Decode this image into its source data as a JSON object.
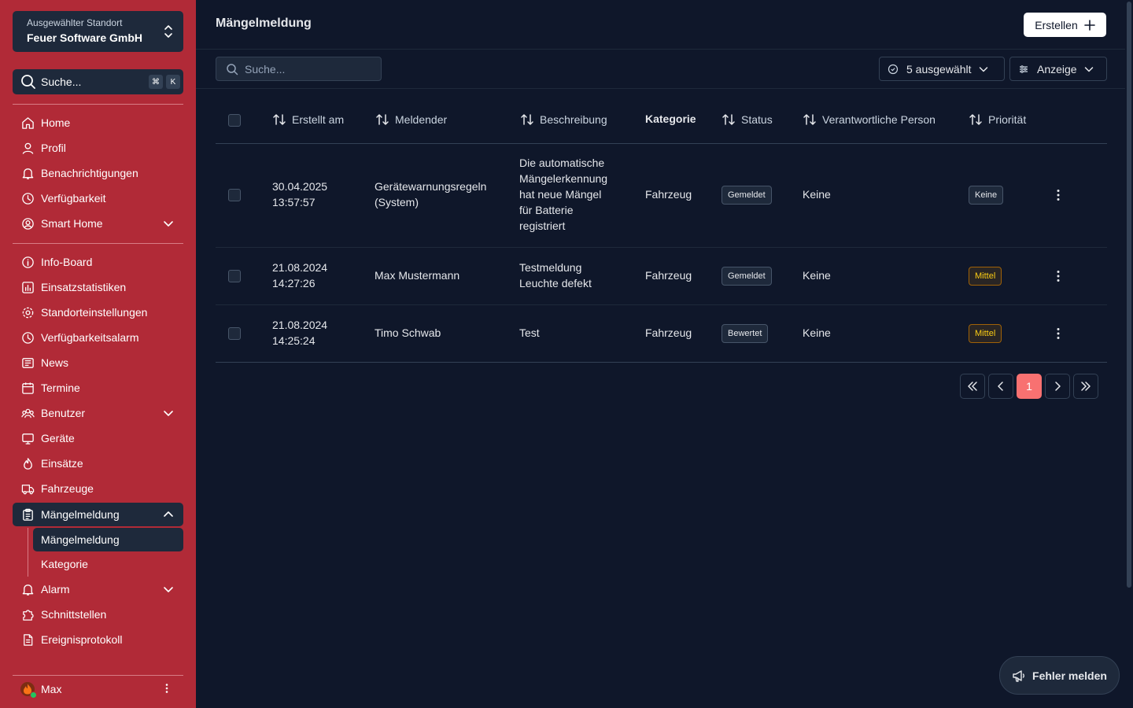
{
  "sidebar": {
    "site_label": "Ausgewählter Standort",
    "site_value": "Feuer Software GmbH",
    "search_label": "Suche...",
    "search_kbd": [
      "⌘",
      "K"
    ],
    "items": [
      {
        "label": "Home"
      },
      {
        "label": "Profil"
      },
      {
        "label": "Benachrichtigungen"
      },
      {
        "label": "Verfügbarkeit"
      },
      {
        "label": "Smart Home"
      },
      {
        "label": "Info-Board"
      },
      {
        "label": "Einsatzstatistiken"
      },
      {
        "label": "Standorteinstellungen"
      },
      {
        "label": "Verfügbarkeitsalarm"
      },
      {
        "label": "News"
      },
      {
        "label": "Termine"
      },
      {
        "label": "Benutzer"
      },
      {
        "label": "Geräte"
      },
      {
        "label": "Einsätze"
      },
      {
        "label": "Fahrzeuge"
      },
      {
        "label": "Mängelmeldung"
      },
      {
        "label": "Alarm"
      },
      {
        "label": "Schnittstellen"
      },
      {
        "label": "Ereignisprotokoll"
      }
    ],
    "subitems": [
      {
        "label": "Mängelmeldung"
      },
      {
        "label": "Kategorie"
      }
    ],
    "user": "Max"
  },
  "header": {
    "title": "Mängelmeldung",
    "create_label": "Erstellen"
  },
  "toolbar": {
    "search_placeholder": "Suche...",
    "selected_label": "5 ausgewählt",
    "view_label": "Anzeige"
  },
  "table": {
    "columns": [
      "Erstellt am",
      "Meldender",
      "Beschreibung",
      "Kategorie",
      "Status",
      "Verantwortliche Person",
      "Priorität"
    ],
    "rows": [
      {
        "created": [
          "30.04.2025",
          "13:57:57"
        ],
        "reporter": [
          "Gerätewarnungsregeln",
          "(System)"
        ],
        "description": [
          "Die automatische",
          "Mängelerkennung",
          "hat neue Mängel",
          "für Batterie",
          "registriert"
        ],
        "category": "Fahrzeug",
        "status": "Gemeldet",
        "responsible": "Keine",
        "priority": "Keine"
      },
      {
        "created": [
          "21.08.2024",
          "14:27:26"
        ],
        "reporter": [
          "Max Mustermann"
        ],
        "description": [
          "Testmeldung",
          "Leuchte defekt"
        ],
        "category": "Fahrzeug",
        "status": "Gemeldet",
        "responsible": "Keine",
        "priority": "Mittel"
      },
      {
        "created": [
          "21.08.2024",
          "14:25:24"
        ],
        "reporter": [
          "Timo Schwab"
        ],
        "description": [
          "Test"
        ],
        "category": "Fahrzeug",
        "status": "Bewertet",
        "responsible": "Keine",
        "priority": "Mittel"
      }
    ]
  },
  "pagination": {
    "current_page": "1"
  },
  "report_button": "Fehler melden",
  "colors": {
    "sidebar": "#b12a37",
    "background": "#0f172a",
    "panel": "#1e293b",
    "accent": "#f87171",
    "priority_mittel": "#facc15"
  }
}
